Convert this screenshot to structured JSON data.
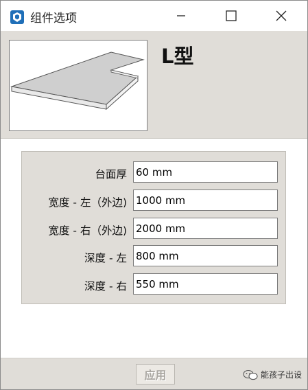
{
  "window": {
    "title": "组件选项"
  },
  "header": {
    "model_name": "L型"
  },
  "form": {
    "fields": [
      {
        "label": "台面厚",
        "value": "60 mm"
      },
      {
        "label": "宽度 - 左（外边)",
        "value": "1000 mm"
      },
      {
        "label": "宽度 - 右（外边)",
        "value": "2000 mm"
      },
      {
        "label": "深度 - 左",
        "value": "800 mm"
      },
      {
        "label": "深度 - 右",
        "value": "550 mm"
      }
    ]
  },
  "footer": {
    "apply_label": "应用",
    "watermark": "能孩子出设"
  },
  "icons": {
    "app": "sketchup-icon",
    "minimize": "minimize-icon",
    "maximize": "maximize-icon",
    "close": "close-icon",
    "watermark": "wechat-icon"
  },
  "colors": {
    "panel_bg": "#e0ddd8",
    "app_icon_blue": "#1f6fb8"
  }
}
